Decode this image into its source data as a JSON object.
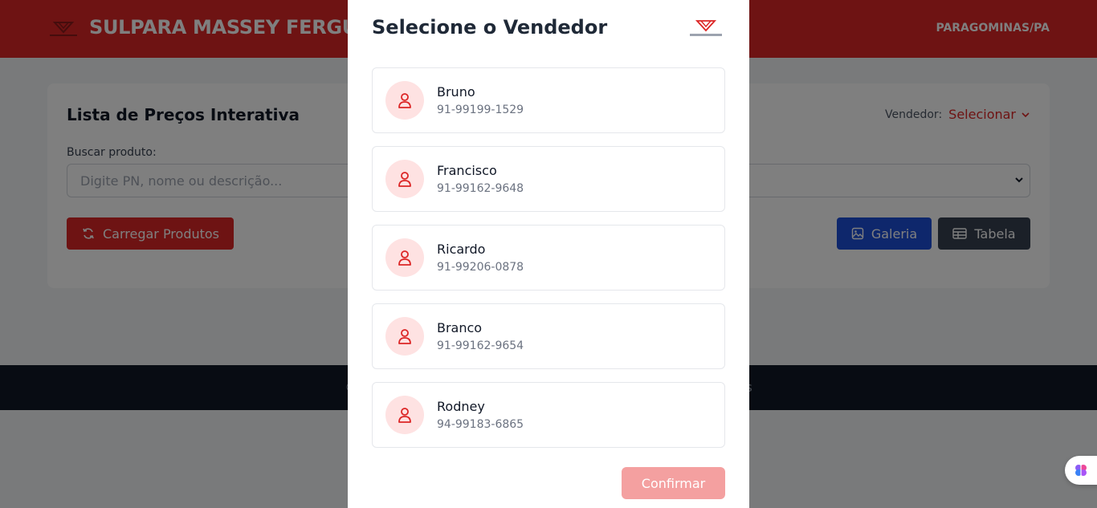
{
  "header": {
    "brand": "SULPARA MASSEY FERGUSON",
    "location": "PARAGOMINAS/PA"
  },
  "main": {
    "title": "Lista de Preços Interativa",
    "seller_label": "Vendedor:",
    "seller_value": "Selecionar",
    "search_label": "Buscar produto:",
    "search_placeholder": "Digite PN, nome ou descrição...",
    "load_button": "Carregar Produtos",
    "gallery_button": "Galeria",
    "table_button": "Tabela"
  },
  "footer": {
    "copy": "© 2025 Sulpara Massey Ferguson. Todos os direitos reservados"
  },
  "modal": {
    "title": "Selecione o Vendedor",
    "sellers": [
      {
        "name": "Bruno",
        "phone": "91-99199-1529"
      },
      {
        "name": "Francisco",
        "phone": "91-99162-9648"
      },
      {
        "name": "Ricardo",
        "phone": "91-99206-0878"
      },
      {
        "name": "Branco",
        "phone": "91-99162-9654"
      },
      {
        "name": "Rodney",
        "phone": "94-99183-6865"
      }
    ],
    "confirm_button": "Confirmar"
  },
  "colors": {
    "brand_red": "#dc2626",
    "gallery_blue": "#1d4ed8",
    "table_gray": "#374151",
    "footer_dark": "#111827"
  },
  "icons": {
    "logo": "massey-ferguson-logo",
    "seller_avatar": "user-icon",
    "load": "refresh-icon",
    "gallery": "image-icon",
    "table": "table-icon",
    "seller_chevron": "chevron-down-icon",
    "assistant": "brain-icon"
  }
}
